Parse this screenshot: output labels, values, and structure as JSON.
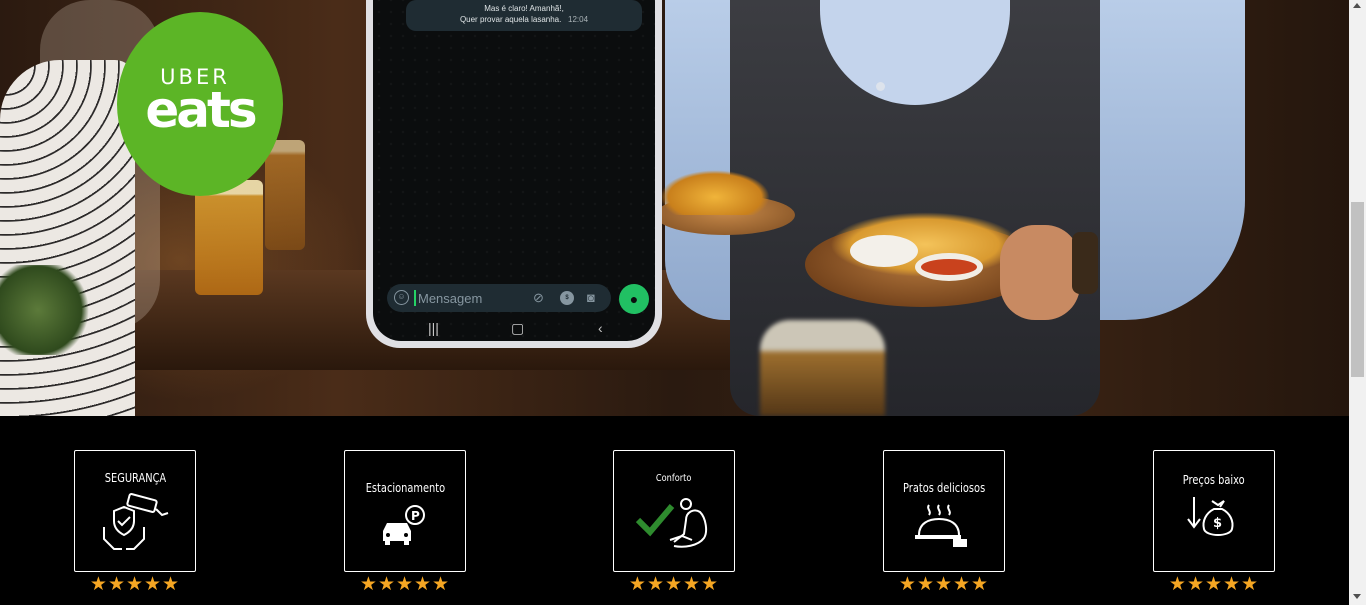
{
  "hero": {
    "logo": {
      "line1": "UBER",
      "line2": "eats"
    },
    "phone": {
      "message_line1": "Mas é claro! Amanhã!,",
      "message_line2": "Quer provar aquela lasanha.",
      "message_time": "12:04",
      "input_placeholder": "Mensagem",
      "icons": [
        "emoji-icon",
        "attach-icon",
        "payment-icon",
        "camera-icon",
        "mic-icon"
      ],
      "nav_icons": [
        "recent-apps-icon",
        "home-icon",
        "back-icon"
      ]
    }
  },
  "features": [
    {
      "label": "SEGURANÇA",
      "icon": "security-camera-hands-icon",
      "rating": "★★★★★"
    },
    {
      "label": "Estacionamento",
      "icon": "car-parking-icon",
      "rating": "★★★★★"
    },
    {
      "label": "Conforto",
      "icon": "comfort-chair-check-icon",
      "rating": "★★★★★"
    },
    {
      "label": "Pratos deliciosos",
      "icon": "cloche-dish-icon",
      "rating": "★★★★★"
    },
    {
      "label": "Preços baixo",
      "icon": "money-bag-down-icon",
      "rating": "★★★★★"
    }
  ],
  "colors": {
    "logo_green": "#5cb526",
    "whatsapp_green": "#21c063",
    "star_orange": "#f5a623",
    "check_green": "#2e8b2e"
  }
}
